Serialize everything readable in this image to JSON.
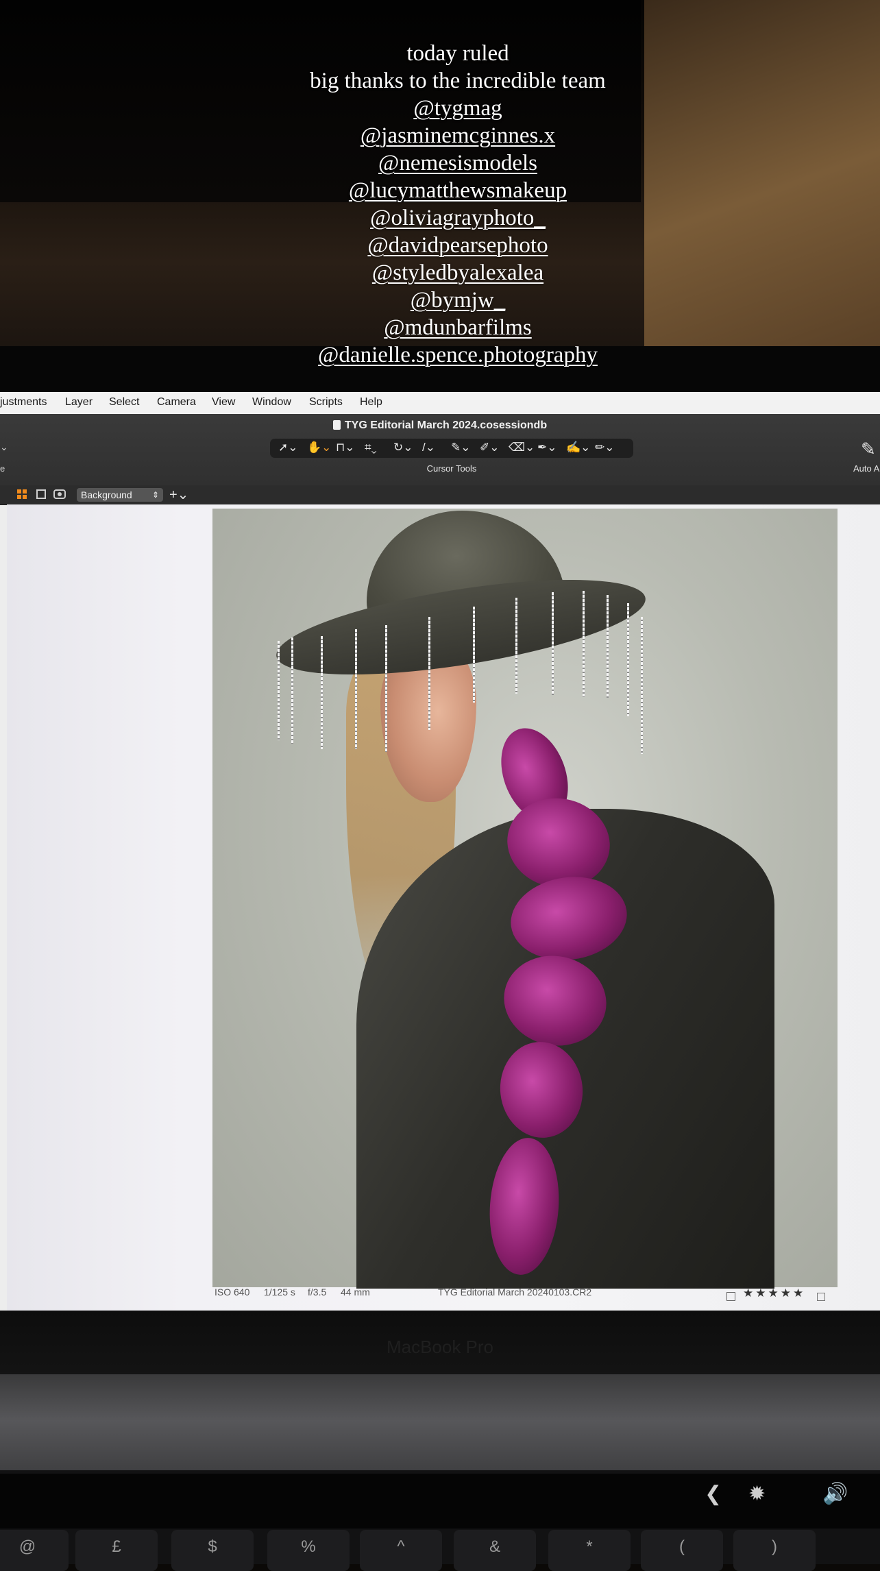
{
  "story_caption": {
    "lines": [
      "today ruled",
      "big thanks to the incredible team"
    ],
    "mentions": [
      "@tygmag",
      "@jasminemcginnes.x",
      "@nemesismodels",
      "@lucymatthewsmakeup",
      "@oliviagrayphoto_",
      "@davidpearsephoto",
      "@styledbyalexalea",
      "@bymjw_",
      "@mdunbarfilms",
      "@danielle.spence.photography"
    ]
  },
  "app": {
    "menu": [
      "justments",
      "Layer",
      "Select",
      "Camera",
      "View",
      "Window",
      "Scripts",
      "Help"
    ],
    "document_title": "TYG Editorial March 2024.cosessiondb",
    "toolbar_label": "Cursor Tools",
    "right_tool_label": "Auto A",
    "left_edge_label": "e",
    "layer_select": "Background",
    "tools": [
      "select-cursor-icon",
      "hand-icon",
      "crop-stamp-icon",
      "crop-icon",
      "rotate-icon",
      "straighten-icon",
      "picker-icon",
      "brush-icon",
      "eraser-icon",
      "color-picker-icon",
      "annotate-icon",
      "pen-icon"
    ]
  },
  "image_info": {
    "iso": "ISO 640",
    "shutter": "1/125 s",
    "aperture": "f/3.5",
    "focal_length": "44 mm",
    "filename": "TYG Editorial March 20240103.CR2",
    "stars": "★★★★★"
  },
  "laptop": {
    "model_label": "MacBook Pro",
    "touchbar": [
      "❮",
      "✹",
      "🔊"
    ],
    "keys": [
      "@",
      "£",
      "$",
      "%",
      "^",
      "&",
      "*",
      "(",
      ")"
    ]
  },
  "colors": {
    "accent_orange": "#f08a1c",
    "ruffle_magenta": "#b8349a"
  }
}
